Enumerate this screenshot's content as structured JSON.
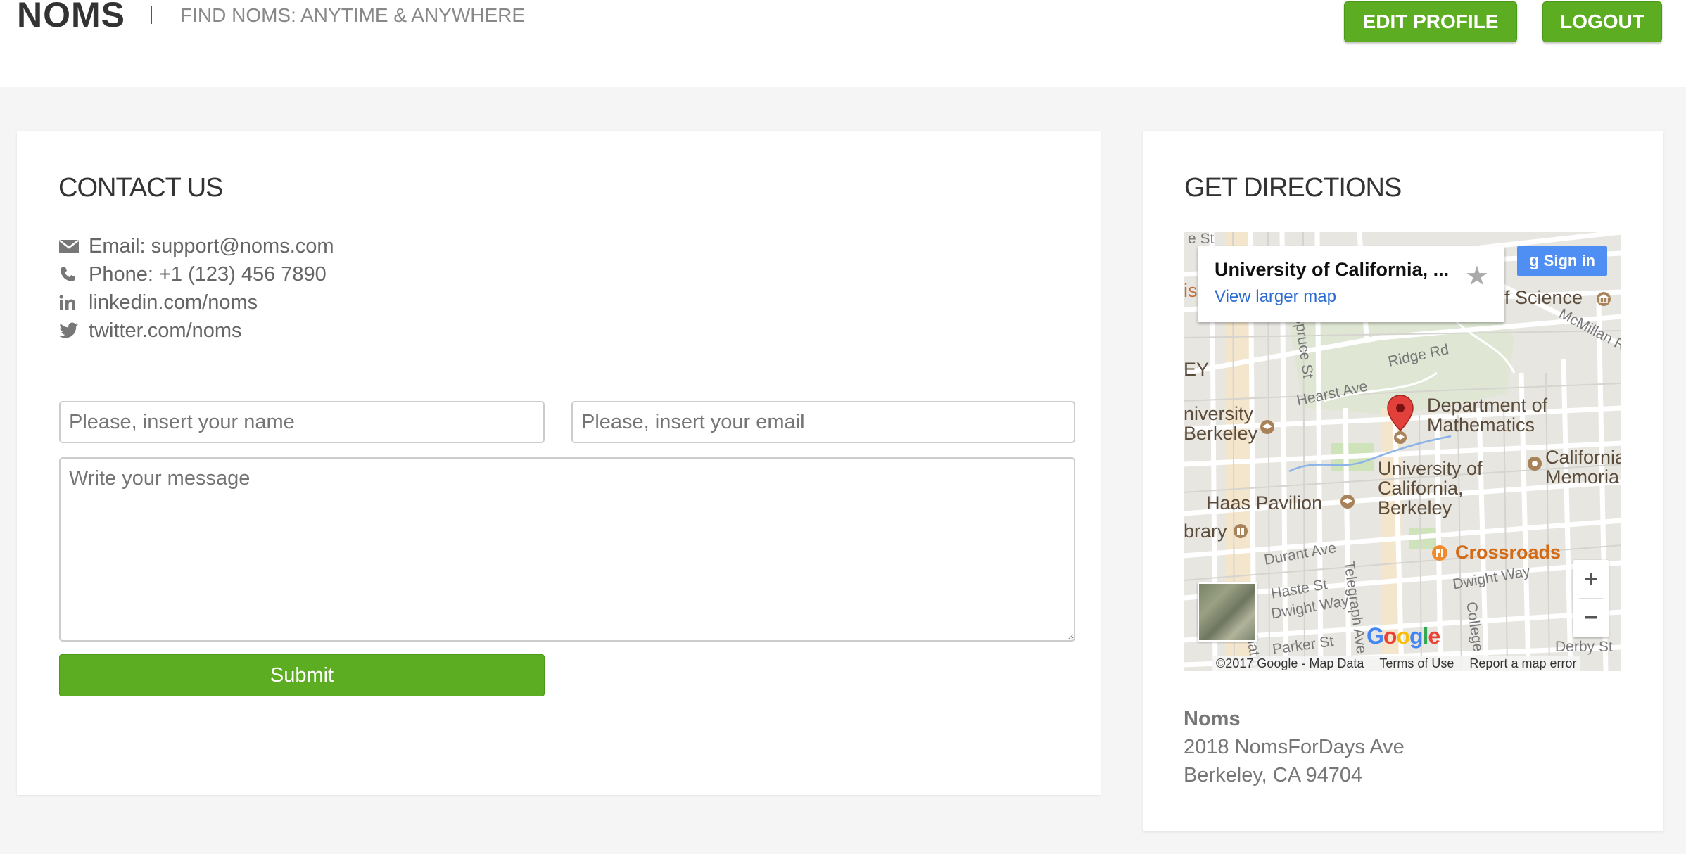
{
  "header": {
    "brand": "NOMS",
    "tagline": "FIND NOMS: ANYTIME & ANYWHERE",
    "edit_profile_label": "EDIT PROFILE",
    "logout_label": "LOGOUT"
  },
  "contact": {
    "title": "CONTACT US",
    "info": [
      {
        "icon": "envelope-icon",
        "text": "Email: support@noms.com"
      },
      {
        "icon": "phone-icon",
        "text": "Phone: +1 (123) 456 7890"
      },
      {
        "icon": "linkedin-icon",
        "text": "linkedin.com/noms"
      },
      {
        "icon": "twitter-icon",
        "text": "twitter.com/noms"
      }
    ],
    "name_placeholder": "Please, insert your name",
    "email_placeholder": "Please, insert your email",
    "message_placeholder": "Write your message",
    "submit_label": "Submit"
  },
  "directions": {
    "title": "GET DIRECTIONS",
    "map": {
      "place_name": "University of California, ...",
      "view_larger": "View larger map",
      "sign_in": "Sign in",
      "zoom_in": "+",
      "zoom_out": "−",
      "google": "Google",
      "footer_copyright": "©2017 Google - Map Data",
      "footer_terms": "Terms of Use",
      "footer_report": "Report a map error",
      "labels": {
        "dept_math": "Department of\nMathematics",
        "uc_berkeley": "University of\nCalifornia,\nBerkeley",
        "haas": "Haas Pavilion",
        "crossroads": "Crossroads",
        "university_berkeley": "niversity\nBerkeley",
        "california_memorial": "California\nMemoria",
        "science": "f Science",
        "library": "brary",
        "mcmillan": "McMillan Rd",
        "ridge": "Ridge Rd",
        "hearst": "Hearst Ave",
        "spruce": "Spruce St",
        "durant": "Durant Ave",
        "haste": "Haste St",
        "dwight_w": "Dwight Way",
        "dwight_e": "Dwight Way",
        "telegraph": "Telegraph Ave",
        "college": "College",
        "parker": "Parker St",
        "derby": "Derby St",
        "shattuck": "Shattu",
        "ey": "EY",
        "is": "is",
        "e_st": "e St"
      }
    },
    "address": {
      "name": "Noms",
      "line1": "2018 NomsForDays Ave",
      "line2": "Berkeley, CA 94704"
    }
  },
  "colors": {
    "accent_green": "#5cad22",
    "map_pin_red": "#d93025",
    "link_blue": "#2a6ad1"
  }
}
